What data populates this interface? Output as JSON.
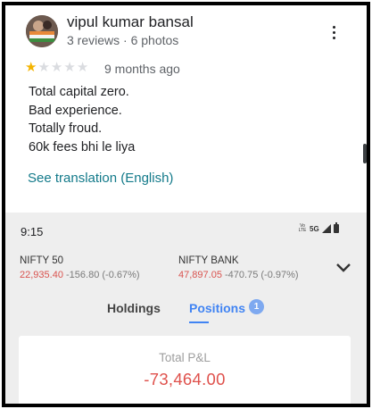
{
  "review": {
    "reviewer_name": "vipul kumar bansal",
    "reviewer_meta": "3 reviews · 6 photos",
    "rating": 1,
    "rating_max": 5,
    "time_ago": "9 months ago",
    "text_lines": [
      "Total capital zero.",
      "Bad experience.",
      "Totally froud.",
      "60k fees bhi le liya"
    ],
    "translation_link": "See translation (English)"
  },
  "phone": {
    "status": {
      "time": "9:15",
      "network_label": "Vo LTE",
      "network_type": "5G"
    },
    "indices": [
      {
        "name": "NIFTY 50",
        "price": "22,935.40",
        "change": "-156.80 (-0.67%)"
      },
      {
        "name": "NIFTY BANK",
        "price": "47,897.05",
        "change": "-470.75 (-0.97%)"
      }
    ],
    "tabs": {
      "holdings": "Holdings",
      "positions": "Positions",
      "positions_badge": "1"
    },
    "pnl": {
      "label": "Total P&L",
      "value": "-73,464.00"
    }
  },
  "colors": {
    "star_filled": "#f4b400",
    "star_empty": "#dadce0",
    "link": "#137a8a",
    "loss_red": "#df514c",
    "accent_blue": "#4184f3"
  },
  "icons": [
    "more-vert-icon",
    "star-icon",
    "signal-icon",
    "battery-icon",
    "chevron-down-icon"
  ]
}
